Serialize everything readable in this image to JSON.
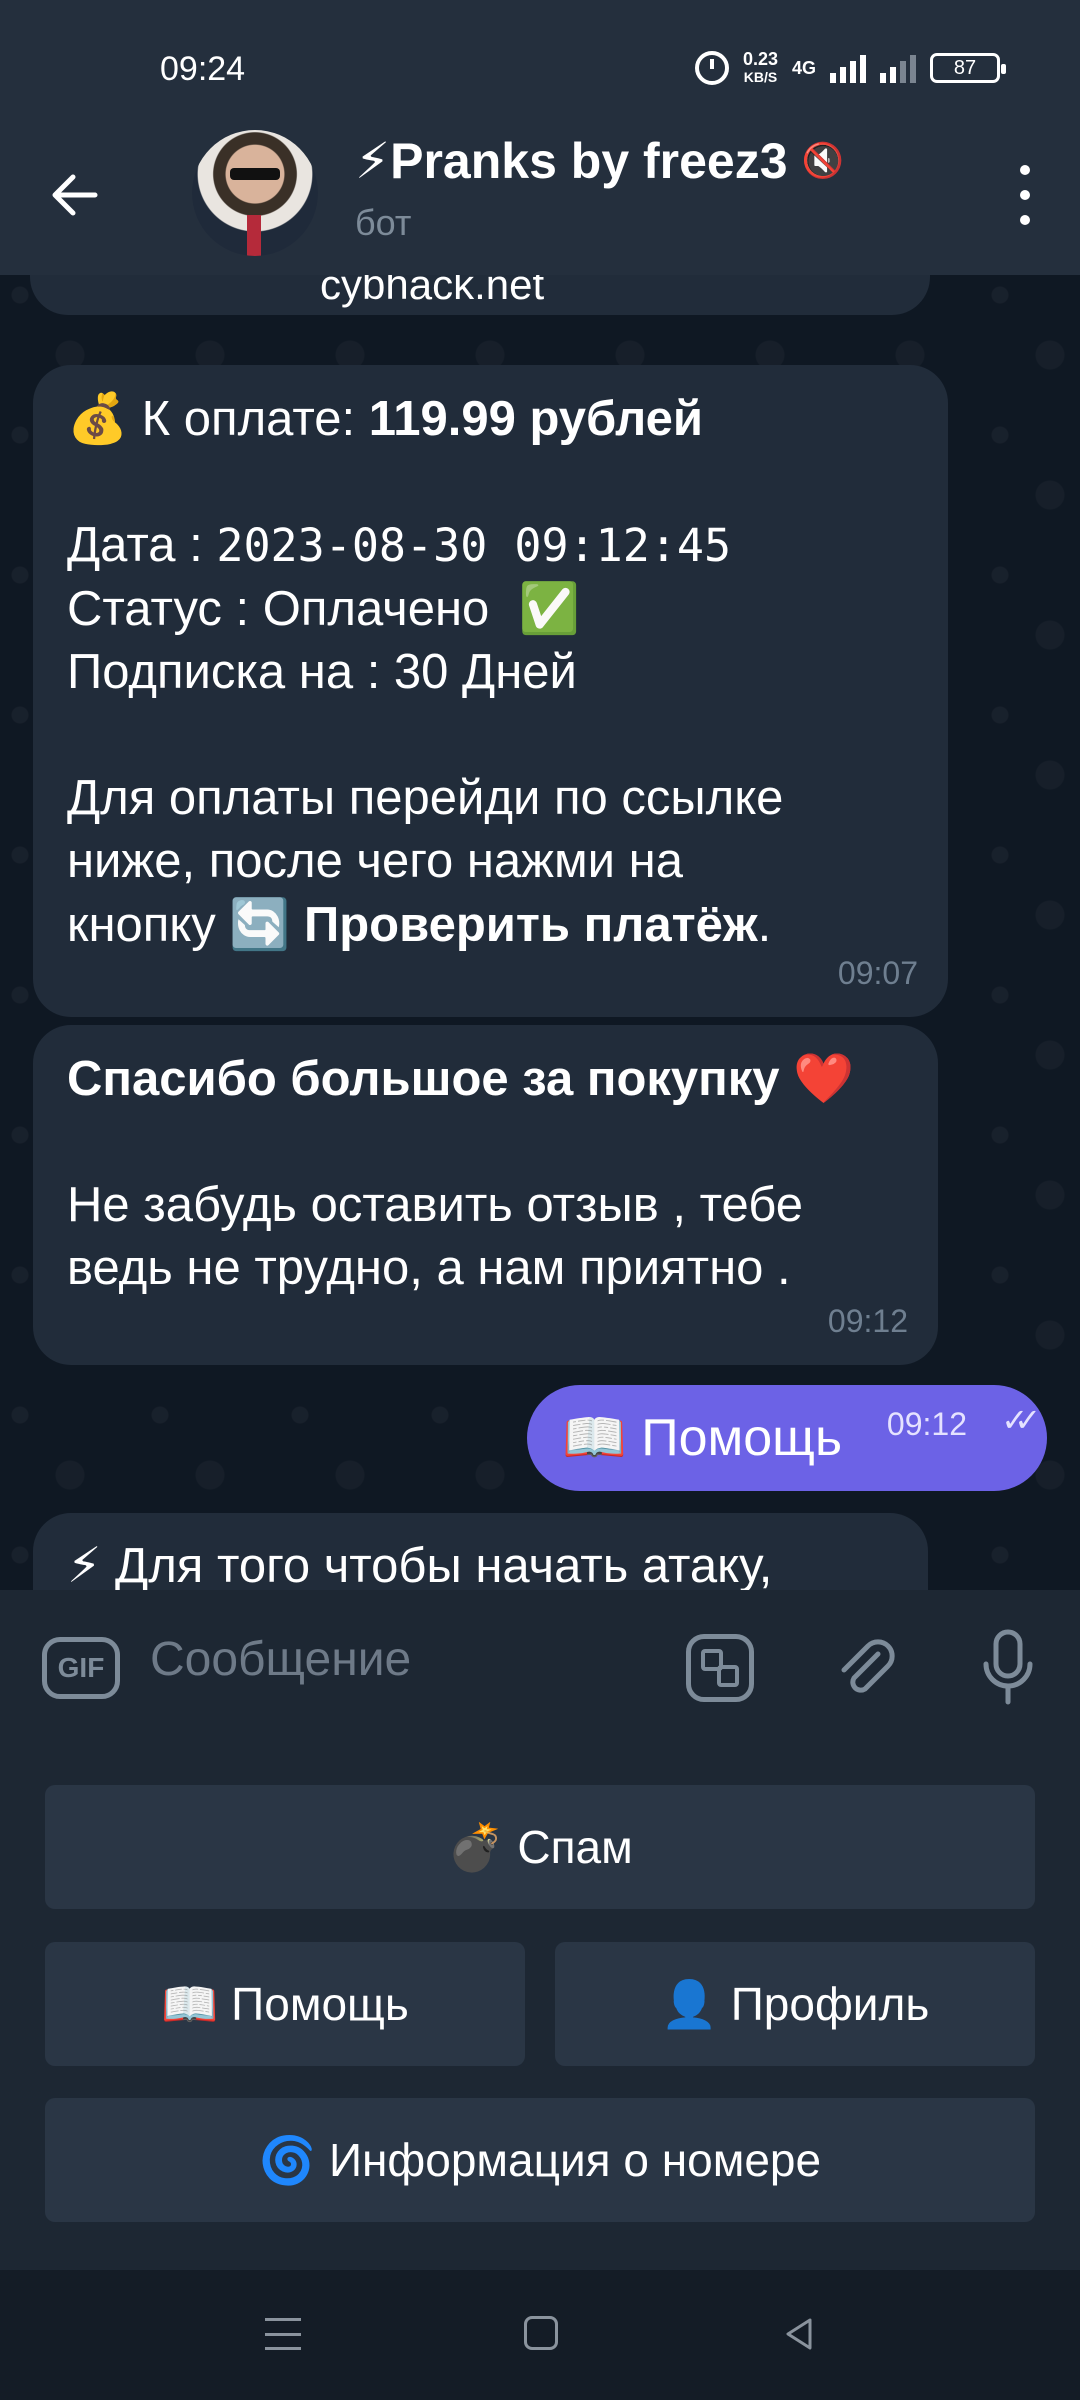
{
  "status_bar": {
    "time": "09:24",
    "net_speed_value": "0.23",
    "net_speed_unit": "KB/S",
    "net_type": "4G",
    "battery": "87"
  },
  "header": {
    "title": "⚡Pranks by freez3",
    "subtitle": "бот"
  },
  "messages": {
    "partial_link": "cybhack.net",
    "payment": {
      "amount_icon": "💰",
      "amount_label": "К оплате: ",
      "amount_value": "119.99 рублей",
      "date_label": "Дата : ",
      "date_value": "2023-08-30 09:12:45",
      "status_label": "Статус : ",
      "status_value": "Оплачено",
      "status_icon": "✅",
      "sub_label": "Подписка на : ",
      "sub_value": "30 Дней",
      "instr_line1": "Для оплаты перейди по ссылке",
      "instr_line2": "ниже, после чего нажми на",
      "instr_line3_prefix": "кнопку ",
      "instr_icon": "🔄",
      "instr_button": "Проверить платёж",
      "instr_suffix": ".",
      "time": "09:07"
    },
    "thanks": {
      "title": "Спасибо большое за покупку",
      "heart": "❤️",
      "line1": "Не забудь оставить отзыв , тебе",
      "line2": "ведь не трудно, а нам приятно .",
      "time": "09:12"
    },
    "outgoing": {
      "text": "📖 Помощь",
      "time": "09:12",
      "check": "✓✓"
    },
    "attack": {
      "text": "⚡ Для того чтобы начать атаку,"
    }
  },
  "input": {
    "gif_label": "GIF",
    "placeholder": "Сообщение"
  },
  "keyboard": {
    "spam": "💣 Спам",
    "help": "📖 Помощь",
    "profile": "👤 Профиль",
    "info": "🌀 Информация о номере"
  },
  "colors": {
    "accent_outgoing": "#6c62e6",
    "bubble": "#212c3a",
    "header": "#242f3d"
  }
}
